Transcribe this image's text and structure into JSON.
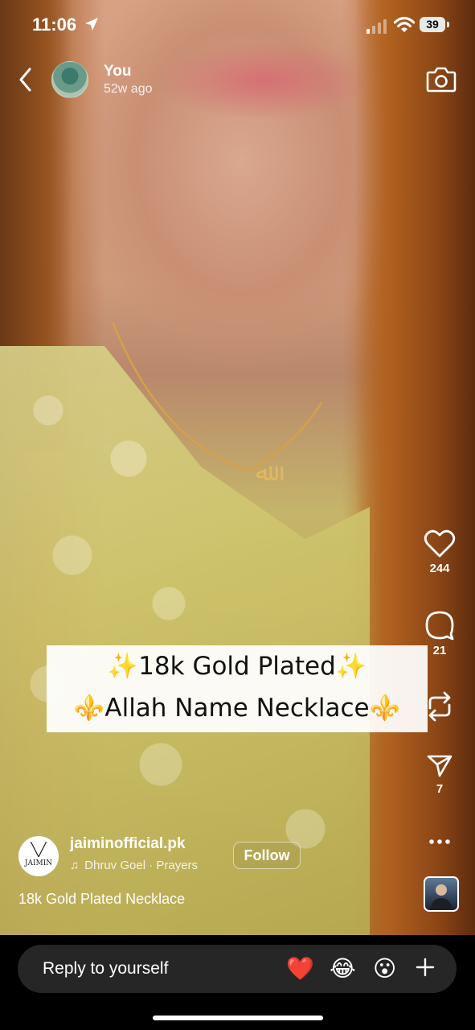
{
  "status_bar": {
    "time": "11:06",
    "battery": "39"
  },
  "header": {
    "username": "You",
    "posted": "52w ago"
  },
  "caption_box": {
    "line1": "✨18k Gold Plated✨",
    "line2": "⚜️Allah Name Necklace⚜️"
  },
  "actions": {
    "likes": "244",
    "comments": "21",
    "shares": "7"
  },
  "author": {
    "logo_text": "JAIMIN",
    "account": "jaiminofficial.pk",
    "music": "Dhruv Goel · Prayers",
    "follow_label": "Follow",
    "description": "18k Gold Plated Necklace"
  },
  "reply_bar": {
    "placeholder": "Reply to yourself",
    "emojis": [
      "❤️",
      "😂",
      "😮"
    ]
  }
}
